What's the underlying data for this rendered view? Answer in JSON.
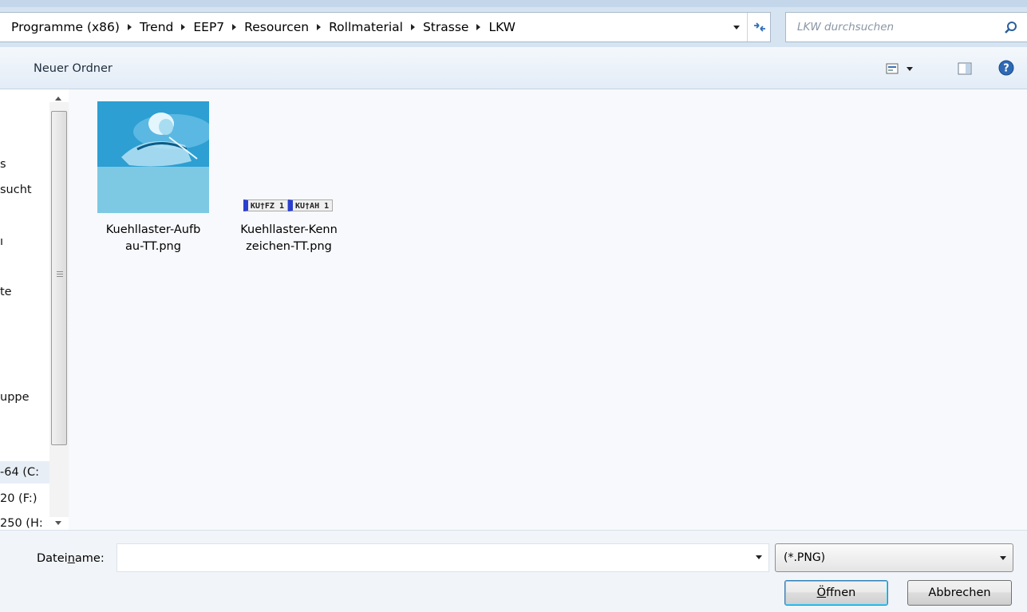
{
  "breadcrumb": [
    "Programme (x86)",
    "Trend",
    "EEP7",
    "Resourcen",
    "Rollmaterial",
    "Strasse",
    "LKW"
  ],
  "search": {
    "placeholder": "LKW durchsuchen"
  },
  "toolbar": {
    "new_folder_label": "Neuer Ordner"
  },
  "nav": {
    "items": [
      {
        "label": "s"
      },
      {
        "label": "sucht"
      },
      {
        "label": "ı"
      },
      {
        "label": "te"
      },
      {
        "label": "uppe"
      },
      {
        "label": "-64 (C:"
      },
      {
        "label": "20 (F:)"
      },
      {
        "label": "250 (H:"
      }
    ]
  },
  "files": [
    {
      "name_line1": "Kuehllaster-Aufb",
      "name_line2": "au-TT.png"
    },
    {
      "name_line1": "Kuehllaster-Kenn",
      "name_line2": "zeichen-TT.png",
      "plate_left": "KU†FZ 1",
      "plate_right": "KU†AH 1"
    }
  ],
  "footer": {
    "filename_label_pre": "Datei",
    "filename_label_u": "n",
    "filename_label_post": "ame:",
    "filename_value": "",
    "filter_value": "(*.PNG)",
    "open_pre": "",
    "open_u": "Ö",
    "open_post": "ffnen",
    "cancel_label": "Abbrechen"
  }
}
